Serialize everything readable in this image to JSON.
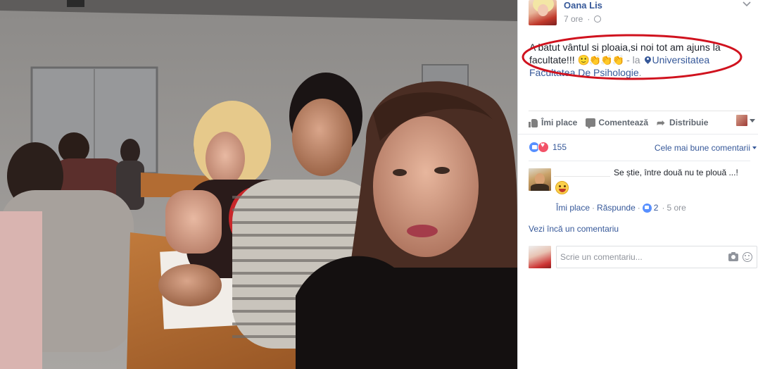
{
  "post": {
    "author": "Oana Lis",
    "time": "7 ore",
    "text_main": "A batut vântul si ploaia,si noi tot am ajuns la facultate!!!",
    "emoji_row": "🙂👏👏👏",
    "place_separator": " - la ",
    "place_name": "Universitatea Facultatea De Psihologie",
    "place_end": "."
  },
  "actions": {
    "like": "Îmi place",
    "comment": "Comentează",
    "share": "Distribuie"
  },
  "reactions": {
    "count": "155",
    "sort": "Cele mai bune comentarii"
  },
  "comment": {
    "text": "Se știe, între două nu te plouă ...!",
    "like_action": "Îmi place",
    "separator": "·",
    "reply_action": "Răspunde",
    "likes": "2",
    "time": "5 ore"
  },
  "view_more": "Vezi încă un comentariu",
  "composer": {
    "placeholder": "Scrie un comentariu..."
  },
  "colors": {
    "link": "#365899",
    "ellipse": "#d0121e",
    "meta": "#90949c"
  }
}
